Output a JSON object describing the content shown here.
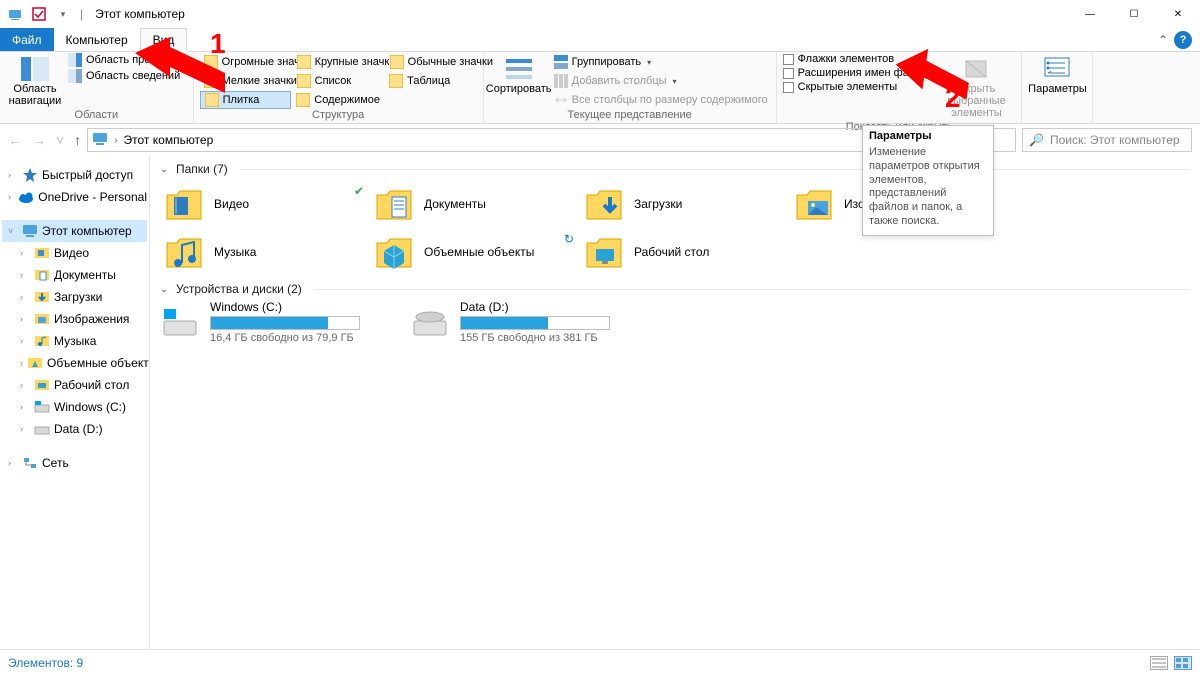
{
  "window": {
    "title": "Этот компьютер",
    "controls": {
      "minimize": "—",
      "maximize": "☐",
      "close": "✕"
    }
  },
  "tabs": {
    "file": "Файл",
    "computer": "Компьютер",
    "view": "Вид",
    "collapse_icon": "⌃",
    "help_icon": "?"
  },
  "ribbon": {
    "panes_group": {
      "title": "Области",
      "nav_pane": "Область\nнавигации",
      "preview_pane": "Область просмотра",
      "details_pane": "Область сведений"
    },
    "layout_group": {
      "title": "Структура",
      "items": [
        [
          "Огромные значки",
          "Крупные значки",
          "Обычные значки"
        ],
        [
          "Мелкие значки",
          "Список",
          "Таблица"
        ],
        [
          "Плитка",
          "Содержимое",
          ""
        ]
      ],
      "selected": "Плитка"
    },
    "current_view_group": {
      "title": "Текущее представление",
      "sort": "Сортировать",
      "group_by": "Группировать",
      "add_columns": "Добавить столбцы",
      "size_columns": "Все столбцы по размеру содержимого"
    },
    "show_hide_group": {
      "title": "Показать или скрыть",
      "item_checkboxes": "Флажки элементов",
      "file_ext": "Расширения имен файлов",
      "hidden_items": "Скрытые элементы",
      "hide_selected": "Скрыть выбранные\nэлементы"
    },
    "options_group": {
      "options": "Параметры"
    }
  },
  "nav": {
    "back": "←",
    "forward": "→",
    "up": "↑",
    "recent": "˅"
  },
  "breadcrumb": {
    "root_chevron": "›",
    "current": "Этот компьютер"
  },
  "search": {
    "placeholder": "Поиск: Этот компьютер",
    "icon": "🔍"
  },
  "tree": [
    {
      "label": "Быстрый доступ",
      "depth": 0,
      "chev": "›",
      "icon": "star",
      "sel": false
    },
    {
      "label": "OneDrive - Personal",
      "depth": 0,
      "chev": "›",
      "icon": "cloud",
      "sel": false
    },
    {
      "spacer": true
    },
    {
      "label": "Этот компьютер",
      "depth": 0,
      "chev": "˅",
      "icon": "pc",
      "sel": true
    },
    {
      "label": "Видео",
      "depth": 1,
      "chev": "›",
      "icon": "video",
      "sel": false
    },
    {
      "label": "Документы",
      "depth": 1,
      "chev": "›",
      "icon": "doc",
      "sel": false
    },
    {
      "label": "Загрузки",
      "depth": 1,
      "chev": "›",
      "icon": "dl",
      "sel": false
    },
    {
      "label": "Изображения",
      "depth": 1,
      "chev": "›",
      "icon": "pic",
      "sel": false
    },
    {
      "label": "Музыка",
      "depth": 1,
      "chev": "›",
      "icon": "music",
      "sel": false
    },
    {
      "label": "Объемные объекты",
      "depth": 1,
      "chev": "›",
      "icon": "3d",
      "sel": false
    },
    {
      "label": "Рабочий стол",
      "depth": 1,
      "chev": "›",
      "icon": "desk",
      "sel": false
    },
    {
      "label": "Windows (C:)",
      "depth": 1,
      "chev": "›",
      "icon": "drv-win",
      "sel": false
    },
    {
      "label": "Data (D:)",
      "depth": 1,
      "chev": "›",
      "icon": "drv",
      "sel": false
    },
    {
      "spacer": true
    },
    {
      "label": "Сеть",
      "depth": 0,
      "chev": "›",
      "icon": "net",
      "sel": false
    }
  ],
  "sections": {
    "folders": {
      "title": "Папки (7)"
    },
    "drives": {
      "title": "Устройства и диски (2)"
    }
  },
  "folders": [
    {
      "name": "Видео",
      "icon": "video",
      "status": "ok"
    },
    {
      "name": "Документы",
      "icon": "doc",
      "status": ""
    },
    {
      "name": "Загрузки",
      "icon": "dl",
      "status": ""
    },
    {
      "name": "Изображения",
      "icon": "pic",
      "status": "cloud"
    },
    {
      "name": "Музыка",
      "icon": "music",
      "status": ""
    },
    {
      "name": "Объемные объекты",
      "icon": "3d",
      "status": "sync"
    },
    {
      "name": "Рабочий стол",
      "icon": "desk",
      "status": ""
    }
  ],
  "drives": [
    {
      "name": "Windows (C:)",
      "free": "16,4 ГБ свободно из 79,9 ГБ",
      "pct": 79
    },
    {
      "name": "Data (D:)",
      "free": "155 ГБ свободно из 381 ГБ",
      "pct": 59
    }
  ],
  "statusbar": {
    "count": "Элементов: 9"
  },
  "tooltip": {
    "title": "Параметры",
    "body": "Изменение параметров открытия элементов, представлений файлов и папок, а также поиска."
  },
  "annotations": {
    "one": "1",
    "two": "2"
  }
}
